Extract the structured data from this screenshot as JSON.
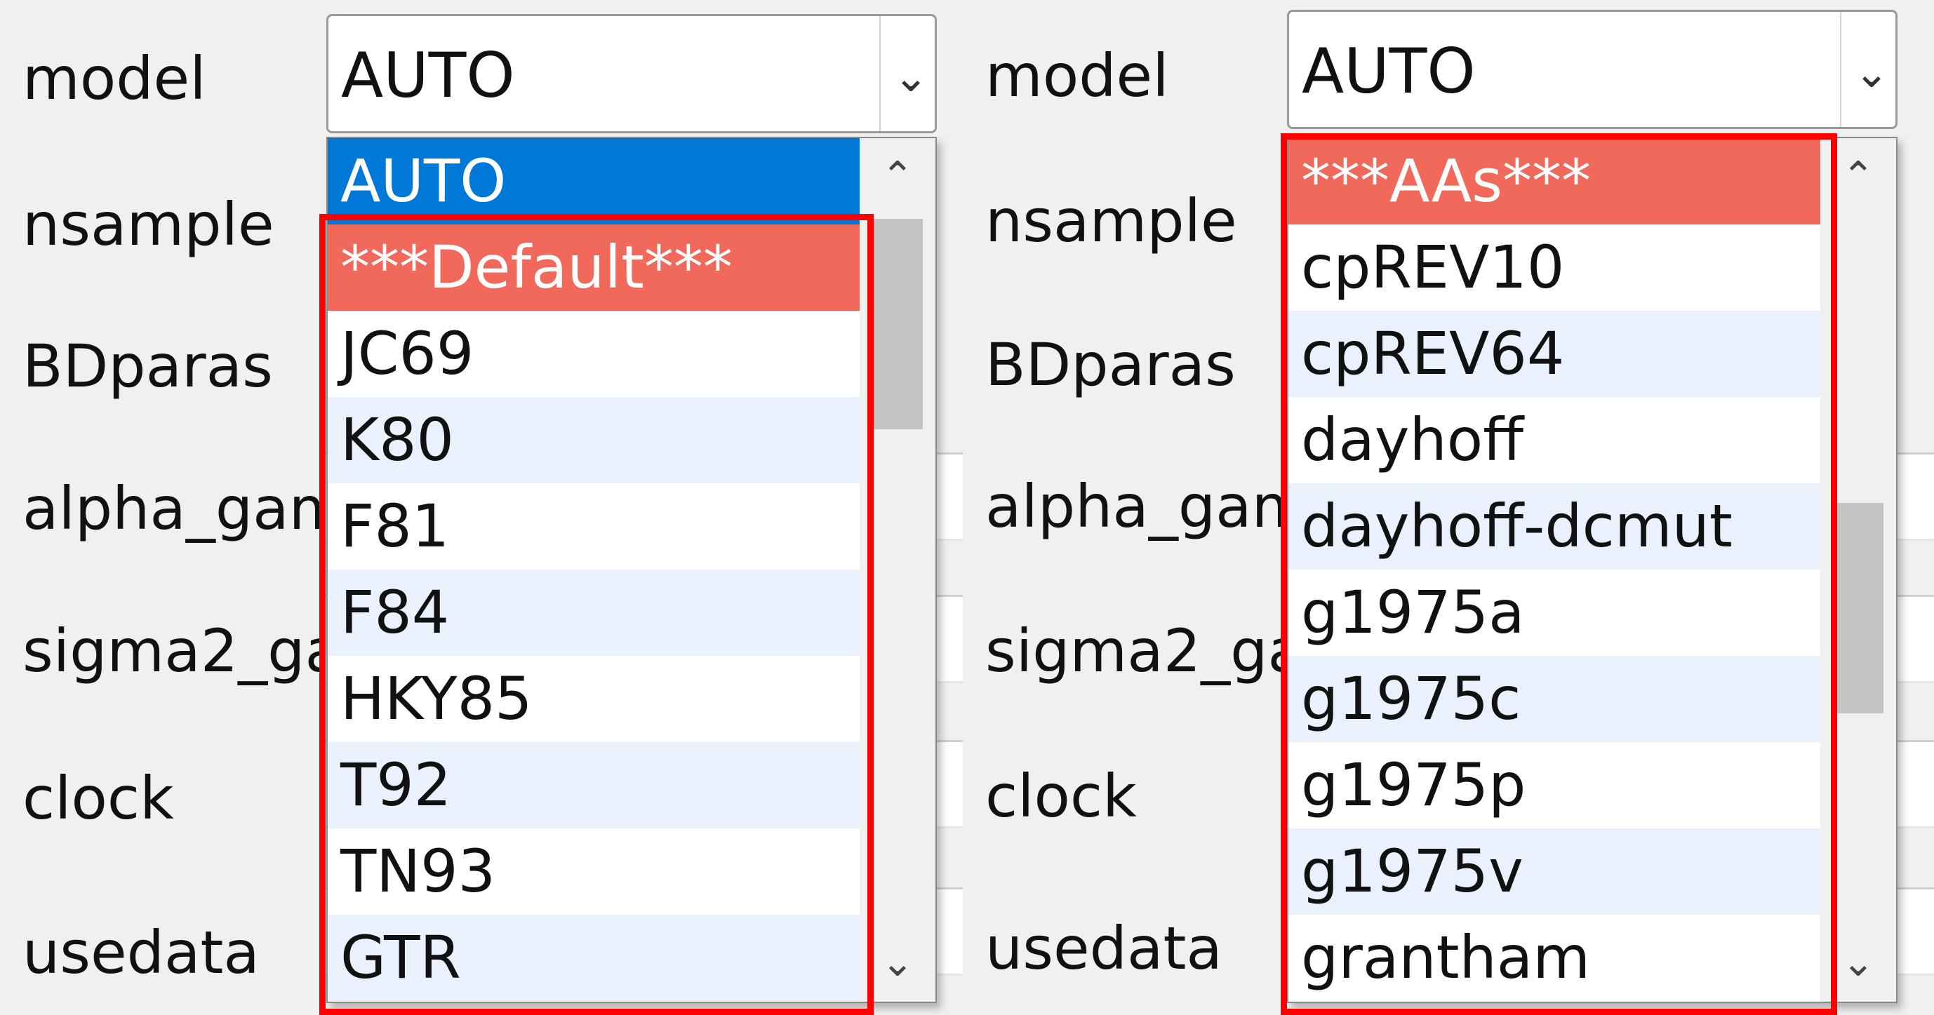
{
  "left_panel": {
    "labels": [
      "model",
      "nsample",
      "BDparas",
      "alpha_gamma",
      "sigma2_gamma",
      "clock",
      "usedata"
    ],
    "combo_value": "AUTO",
    "options": [
      "AUTO",
      "***Default***",
      "JC69",
      "K80",
      "F81",
      "F84",
      "HKY85",
      "T92",
      "TN93",
      "GTR"
    ]
  },
  "right_panel": {
    "labels": [
      "model",
      "nsample",
      "BDparas",
      "alpha_gamma",
      "sigma2_gamma",
      "clock",
      "usedata"
    ],
    "combo_value": "AUTO",
    "options": [
      "***AAs***",
      "cpREV10",
      "cpREV64",
      "dayhoff",
      "dayhoff-dcmut",
      "g1975a",
      "g1975c",
      "g1975p",
      "g1975v",
      "grantham"
    ]
  },
  "colors": {
    "selected": "#0078d7",
    "group_header": "#f0695a",
    "highlight_box": "#ff0000",
    "alt_row": "#eaf1fc"
  },
  "icons": {
    "combo_arrow": "chevron-down-icon",
    "scroll_up": "chevron-up-icon",
    "scroll_down": "chevron-down-icon"
  }
}
